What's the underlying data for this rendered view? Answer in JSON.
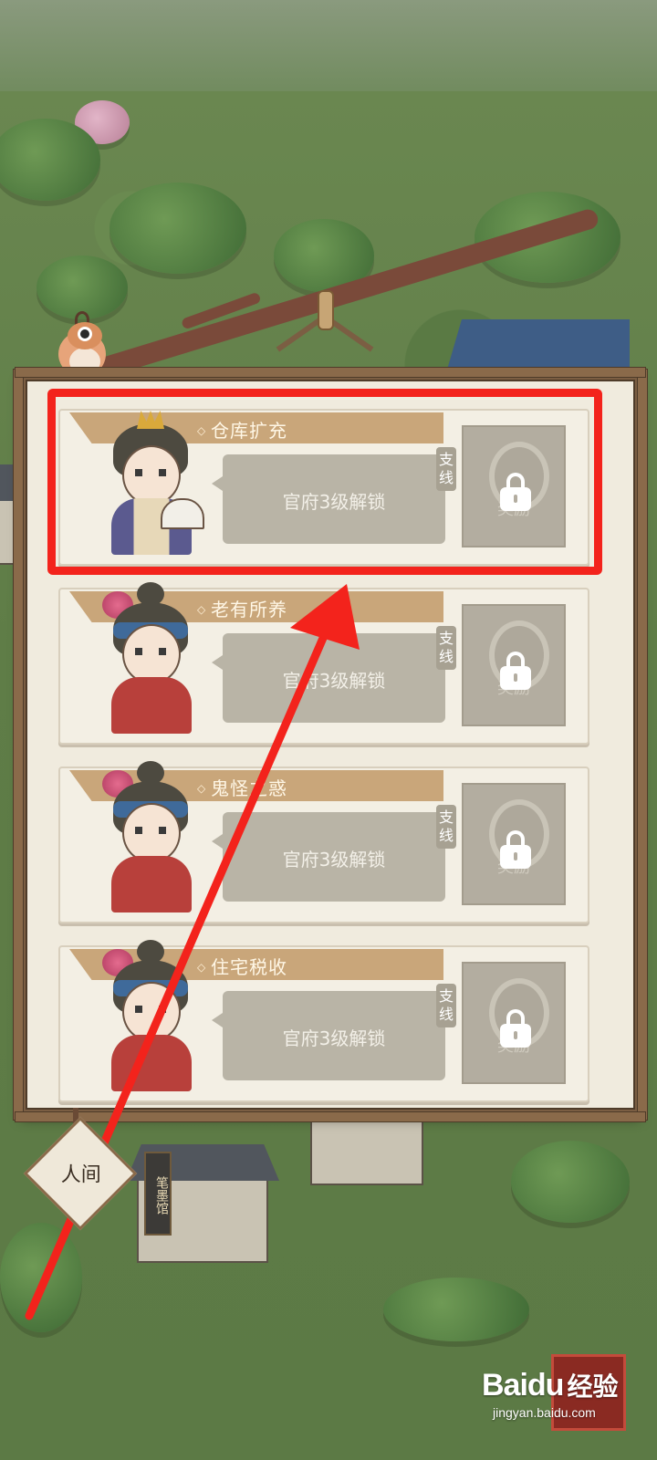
{
  "quests": [
    {
      "title": "仓库扩充",
      "unlock": "官府3级解锁",
      "branch_tag": "支线",
      "reward_label": "奖励",
      "character": "lady"
    },
    {
      "title": "老有所养",
      "unlock": "官府3级解锁",
      "branch_tag": "支线",
      "reward_label": "奖励",
      "character": "clerk"
    },
    {
      "title": "鬼怪之惑",
      "unlock": "官府3级解锁",
      "branch_tag": "支线",
      "reward_label": "奖励",
      "character": "clerk"
    },
    {
      "title": "住宅税收",
      "unlock": "官府3级解锁",
      "branch_tag": "支线",
      "reward_label": "奖励",
      "character": "clerk"
    }
  ],
  "world_tab": "人间",
  "shop_sign": "笔墨馆",
  "watermark": {
    "brand": "Baidu",
    "sub": "经验",
    "url": "jingyan.baidu.com"
  },
  "colors": {
    "highlight": "#f3231c",
    "frame": "#7b5e43",
    "tag": "#c9a67a"
  }
}
